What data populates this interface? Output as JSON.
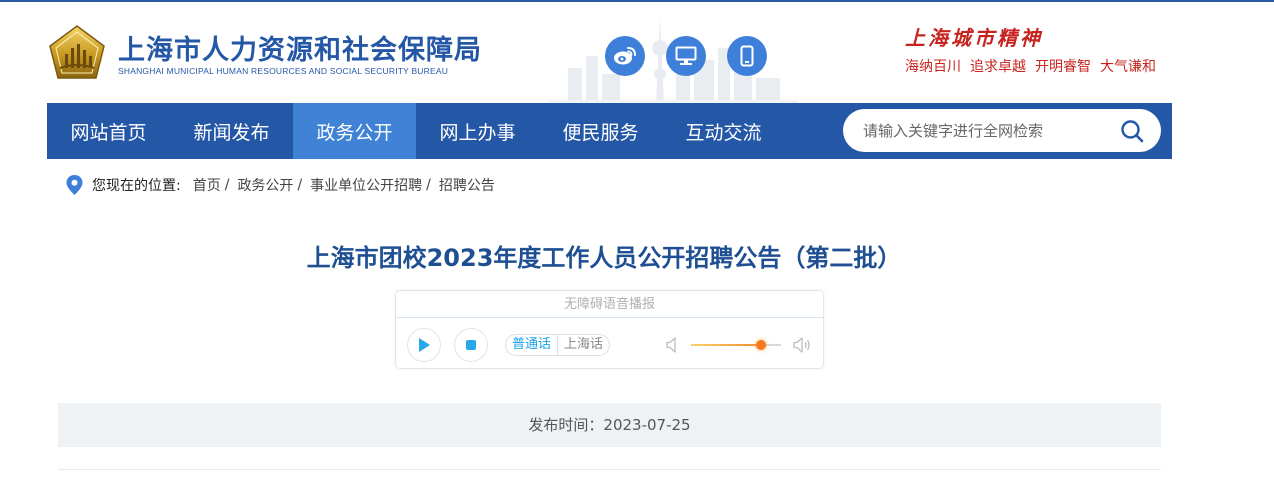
{
  "header": {
    "site_title": "上海市人力资源和社会保障局",
    "site_subtitle": "SHANGHAI MUNICIPAL HUMAN RESOURCES AND SOCIAL SECURITY BUREAU",
    "icons": [
      "weibo-icon",
      "desktop-icon",
      "mobile-icon"
    ],
    "spirit_title": "上海城市精神",
    "spirit_words": [
      "海纳百川",
      "追求卓越",
      "开明睿智",
      "大气谦和"
    ]
  },
  "nav": {
    "items": [
      {
        "label": "网站首页",
        "active": false
      },
      {
        "label": "新闻发布",
        "active": false
      },
      {
        "label": "政务公开",
        "active": true
      },
      {
        "label": "网上办事",
        "active": false
      },
      {
        "label": "便民服务",
        "active": false
      },
      {
        "label": "互动交流",
        "active": false
      }
    ],
    "search_placeholder": "请输入关键字进行全网检索"
  },
  "breadcrumb": {
    "label": "您现在的位置:",
    "items": [
      "首页",
      "政务公开",
      "事业单位公开招聘",
      "招聘公告"
    ],
    "separator": "/"
  },
  "article": {
    "title": "上海市团校2023年度工作人员公开招聘公告（第二批）",
    "publish_text": "发布时间：2023-07-25"
  },
  "player": {
    "title": "无障碍语音播报",
    "lang_active": "普通话",
    "lang_other": "上海话",
    "volume": 0.78
  },
  "colors": {
    "brand_blue": "#2557a7",
    "nav_active": "#3f82d6",
    "title_blue": "#1d4f92",
    "spirit_red": "#c8241f",
    "icon_blue": "#3d7fd9"
  }
}
